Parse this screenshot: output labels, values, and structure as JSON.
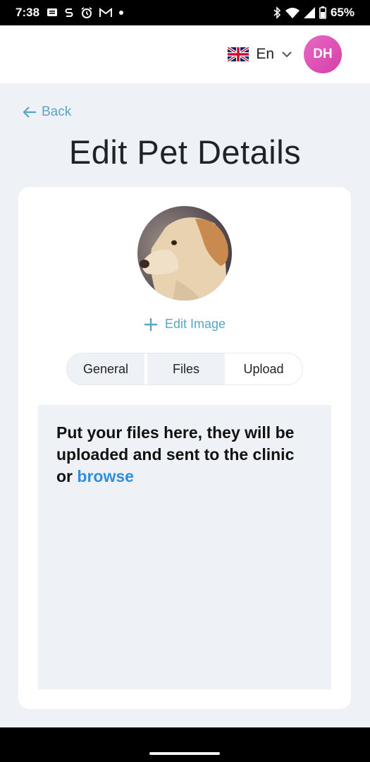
{
  "status_bar": {
    "time": "7:38",
    "battery": "65%",
    "icons": [
      "message-icon",
      "s-app-icon",
      "alarm-icon",
      "gmail-icon",
      "dot-icon",
      "bluetooth-icon",
      "wifi-icon",
      "signal-icon",
      "battery-icon"
    ]
  },
  "header": {
    "language": "En",
    "language_flag": "uk-flag-icon",
    "avatar_initials": "DH",
    "avatar_color": "#e054bb"
  },
  "nav": {
    "back_label": "Back"
  },
  "page": {
    "title": "Edit Pet Details"
  },
  "pet": {
    "edit_image_label": "Edit Image"
  },
  "tabs": [
    {
      "label": "General",
      "active": false
    },
    {
      "label": "Files",
      "active": false
    },
    {
      "label": "Upload",
      "active": true
    }
  ],
  "upload": {
    "instruction": "Put your files here, they will be uploaded and sent to the clinic or",
    "browse_label": "browse"
  },
  "colors": {
    "accent": "#5aa5c6",
    "link": "#2f8fdf",
    "background": "#eef1f6"
  }
}
